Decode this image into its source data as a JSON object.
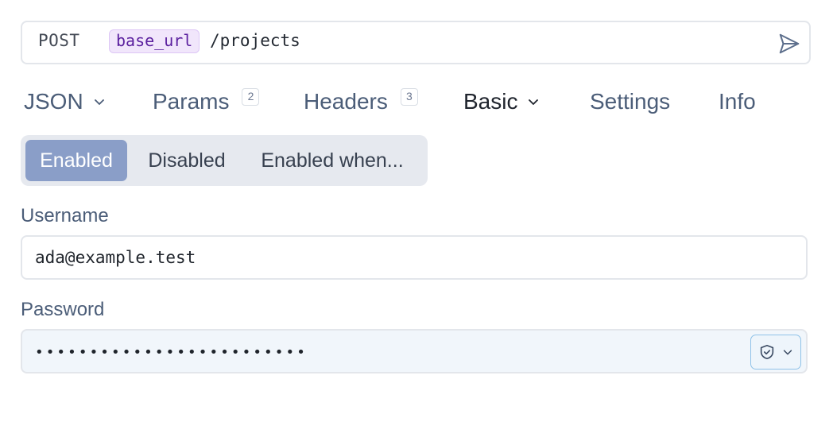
{
  "request": {
    "method": "POST",
    "variable": "base_url",
    "path": "/projects"
  },
  "icons": {
    "send": "send-icon",
    "chevron": "chevron-down-icon",
    "shield": "shield-check-icon"
  },
  "tabs": [
    {
      "label": "JSON",
      "has_chevron": true
    },
    {
      "label": "Params",
      "count": "2"
    },
    {
      "label": "Headers",
      "count": "3"
    },
    {
      "label": "Basic",
      "has_chevron": true,
      "active": true
    },
    {
      "label": "Settings"
    },
    {
      "label": "Info"
    }
  ],
  "auth_mode": {
    "options": [
      "Enabled",
      "Disabled",
      "Enabled when..."
    ],
    "selected": "Enabled"
  },
  "username": {
    "label": "Username",
    "value": "ada@example.test"
  },
  "password": {
    "label": "Password",
    "value": "•••••••••••••••••••••••••"
  },
  "colors": {
    "accent": "#8a9ec8",
    "variable_chip_bg": "#f1e6fb",
    "variable_chip_text": "#5a1f9e"
  }
}
